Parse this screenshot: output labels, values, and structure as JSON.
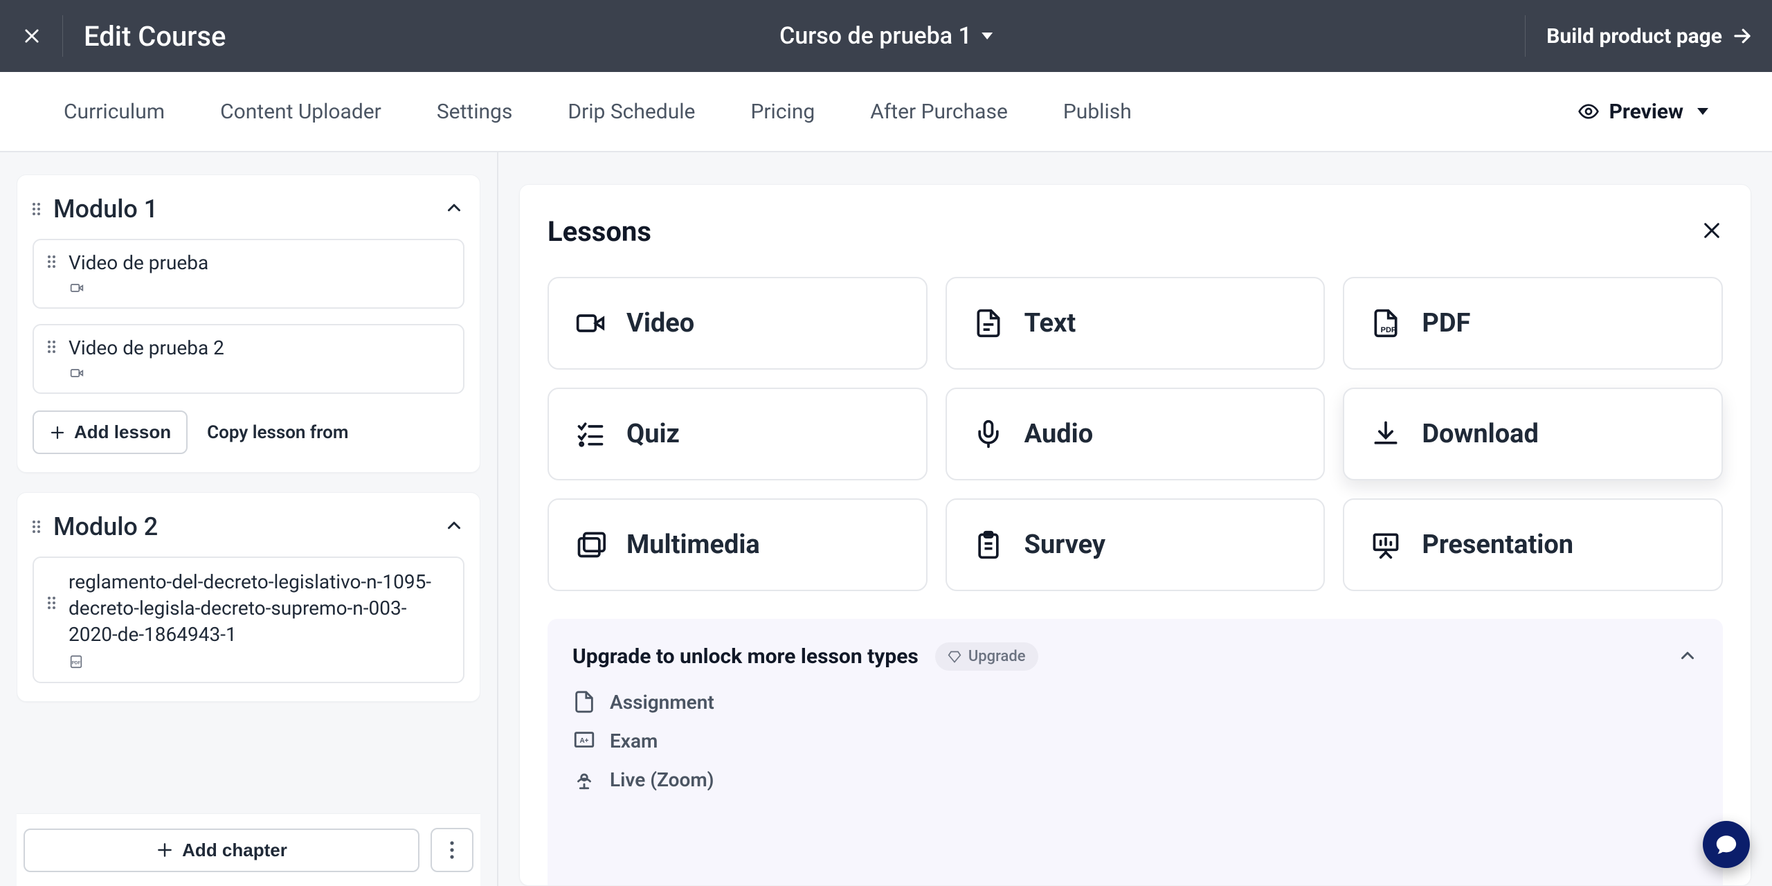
{
  "header": {
    "title": "Edit Course",
    "course_name": "Curso de prueba 1",
    "build_button": "Build product page"
  },
  "tabs": [
    "Curriculum",
    "Content Uploader",
    "Settings",
    "Drip Schedule",
    "Pricing",
    "After Purchase",
    "Publish"
  ],
  "preview_label": "Preview",
  "sidebar": {
    "chapters": [
      {
        "title": "Modulo 1",
        "lessons": [
          {
            "title": "Video de prueba",
            "type": "video"
          },
          {
            "title": "Video de prueba 2",
            "type": "video"
          }
        ]
      },
      {
        "title": "Modulo 2",
        "lessons": [
          {
            "title": "reglamento-del-decreto-legislativo-n-1095-decreto-legisla-decreto-supremo-n-003-2020-de-1864943-1",
            "type": "pdf"
          }
        ]
      }
    ],
    "add_lesson": "Add lesson",
    "copy_lesson": "Copy lesson from",
    "add_chapter": "Add chapter"
  },
  "panel": {
    "title": "Lessons",
    "lesson_types": [
      {
        "key": "video",
        "label": "Video"
      },
      {
        "key": "text",
        "label": "Text"
      },
      {
        "key": "pdf",
        "label": "PDF"
      },
      {
        "key": "quiz",
        "label": "Quiz"
      },
      {
        "key": "audio",
        "label": "Audio"
      },
      {
        "key": "download",
        "label": "Download"
      },
      {
        "key": "multimedia",
        "label": "Multimedia"
      },
      {
        "key": "survey",
        "label": "Survey"
      },
      {
        "key": "presentation",
        "label": "Presentation"
      }
    ],
    "upgrade": {
      "title": "Upgrade to unlock more lesson types",
      "pill": "Upgrade",
      "locked": [
        {
          "key": "assignment",
          "label": "Assignment"
        },
        {
          "key": "exam",
          "label": "Exam"
        },
        {
          "key": "live",
          "label": "Live (Zoom)"
        }
      ]
    }
  }
}
